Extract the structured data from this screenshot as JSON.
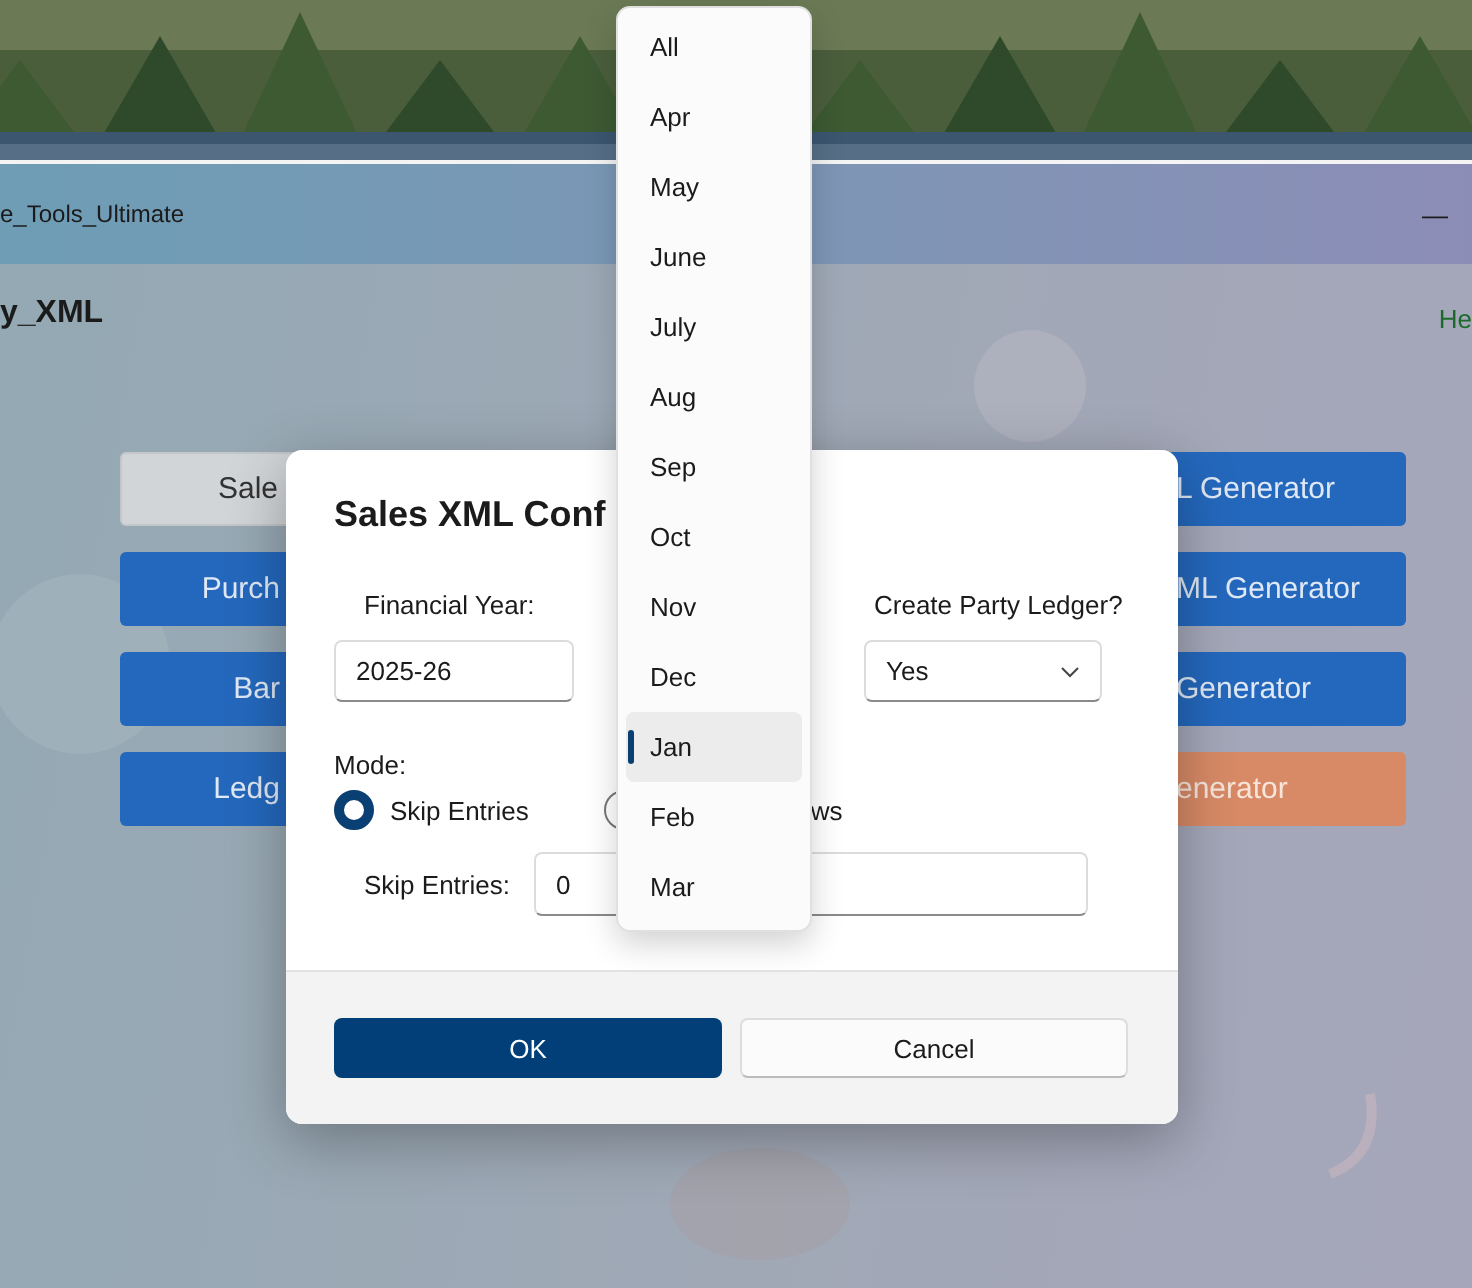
{
  "window": {
    "title": "e_Tools_Ultimate",
    "minimize": "—"
  },
  "page": {
    "heading": "y_XML",
    "link": "He"
  },
  "buttons_left": [
    {
      "label": "Sale",
      "kind": "neutral"
    },
    {
      "label": "Purch",
      "kind": "primary"
    },
    {
      "label": "Bar",
      "kind": "primary"
    },
    {
      "label": "Ledg",
      "kind": "primary"
    }
  ],
  "buttons_right": [
    {
      "label": "L Generator",
      "kind": "primary"
    },
    {
      "label": "ML Generator",
      "kind": "primary"
    },
    {
      "label": "Generator",
      "kind": "primary"
    },
    {
      "label": "enerator",
      "kind": "accent"
    }
  ],
  "dialog": {
    "title": "Sales XML Conf",
    "financial_year": {
      "label": "Financial Year:",
      "value": "2025-26"
    },
    "party_ledger": {
      "label": "Create Party Ledger?",
      "value": "Yes"
    },
    "mode": {
      "label": "Mode:",
      "options": [
        {
          "label": "Skip Entries",
          "selected": true
        },
        {
          "label": "ws",
          "selected": false
        }
      ]
    },
    "skip_entries": {
      "label": "Skip Entries:",
      "value": "0"
    },
    "buttons": [
      {
        "label": "OK",
        "kind": "primary"
      },
      {
        "label": "Cancel",
        "kind": "secondary"
      }
    ]
  },
  "dropdown": {
    "items": [
      {
        "label": "All",
        "selected": false
      },
      {
        "label": "Apr",
        "selected": false
      },
      {
        "label": "May",
        "selected": false
      },
      {
        "label": "June",
        "selected": false
      },
      {
        "label": "July",
        "selected": false
      },
      {
        "label": "Aug",
        "selected": false
      },
      {
        "label": "Sep",
        "selected": false
      },
      {
        "label": "Oct",
        "selected": false
      },
      {
        "label": "Nov",
        "selected": false
      },
      {
        "label": "Dec",
        "selected": false
      },
      {
        "label": "Jan",
        "selected": true
      },
      {
        "label": "Feb",
        "selected": false
      },
      {
        "label": "Mar",
        "selected": false
      }
    ]
  }
}
